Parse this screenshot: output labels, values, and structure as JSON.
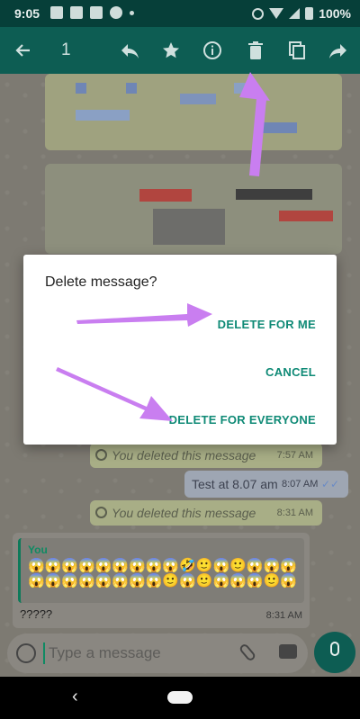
{
  "status_bar": {
    "time": "9:05",
    "battery": "100%"
  },
  "action_bar": {
    "back_icon": "arrow-back-icon",
    "selected_count": "1",
    "actions": [
      "reply-icon",
      "star-icon",
      "info-icon",
      "delete-icon",
      "copy-icon",
      "forward-icon"
    ]
  },
  "dialog": {
    "title": "Delete message?",
    "delete_for_me": "DELETE FOR ME",
    "cancel": "CANCEL",
    "delete_for_everyone": "DELETE FOR EVERYONE"
  },
  "messages": [
    {
      "text": "You deleted this message",
      "time": "7:57 AM"
    },
    {
      "text": "Test at 8.07 am",
      "time": "8:07 AM"
    },
    {
      "text": "You deleted this message",
      "time": "8:31 AM"
    }
  ],
  "reply_message": {
    "quoted_author": "You",
    "quoted_text": "😱😱😱😱😱😱😱😱😱🤣🙂😱🙂😱😱😱😱😱😱😱😱😱😱😱🙂😱🙂😱😱😱🙂😱",
    "text": "?????",
    "time": "8:31 AM"
  },
  "input": {
    "placeholder": "Type a message"
  },
  "colors": {
    "header": "#0d5d53",
    "statusbar": "#063f39",
    "accent": "#0f8a76",
    "annotation": "#c97ef0"
  }
}
